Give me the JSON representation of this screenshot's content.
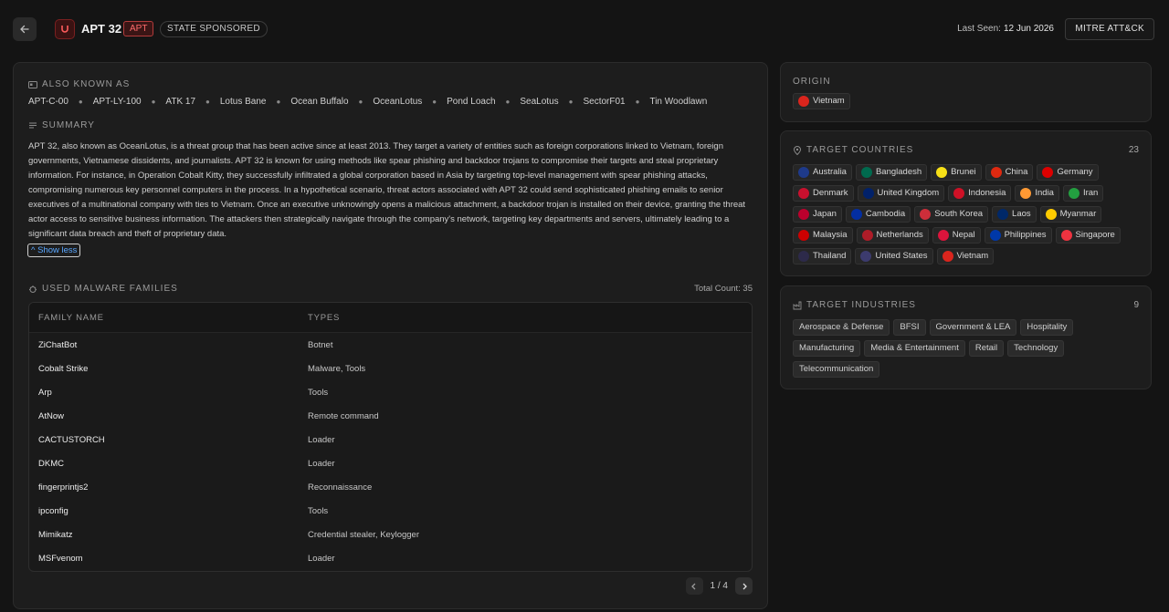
{
  "header": {
    "back_icon": "arrow-left-icon",
    "title": "APT 32",
    "apt_badge": "APT",
    "state_badge": "STATE SPONSORED",
    "last_seen_label": "Last Seen:",
    "last_seen_value": "12 Jun 2026",
    "mitre_button": "MITRE ATT&CK"
  },
  "aka": {
    "label": "ALSO KNOWN AS",
    "names": [
      "APT-C-00",
      "APT-LY-100",
      "ATK 17",
      "Lotus Bane",
      "Ocean Buffalo",
      "OceanLotus",
      "Pond Loach",
      "SeaLotus",
      "SectorF01",
      "Tin Woodlawn"
    ]
  },
  "summary": {
    "label": "SUMMARY",
    "text": "APT 32, also known as OceanLotus, is a threat group that has been active since at least 2013. They target a variety of entities such as foreign corporations linked to Vietnam, foreign governments, Vietnamese dissidents, and journalists. APT 32 is known for using methods like spear phishing and backdoor trojans to compromise their targets and steal proprietary information. For instance, in Operation Cobalt Kitty, they successfully infiltrated a global corporation based in Asia by targeting top-level management with spear phishing attacks, compromising numerous key personnel computers in the process. In a hypothetical scenario, threat actors associated with APT 32 could send sophisticated phishing emails to senior executives of a multinational company with ties to Vietnam. Once an executive unknowingly opens a malicious attachment, a backdoor trojan is installed on their device, granting the threat actor access to sensitive business information. The attackers then strategically navigate through the company's network, targeting key departments and servers, ultimately leading to a significant data breach and theft of proprietary data.",
    "show_less": "Show less"
  },
  "malware": {
    "label": "USED MALWARE FAMILIES",
    "total_count": "Total Count: 35",
    "col_family": "FAMILY NAME",
    "col_types": "TYPES",
    "rows": [
      {
        "name": "ZiChatBot",
        "types": "Botnet"
      },
      {
        "name": "Cobalt Strike",
        "types": "Malware, Tools"
      },
      {
        "name": "Arp",
        "types": "Tools"
      },
      {
        "name": "AtNow",
        "types": "Remote command"
      },
      {
        "name": "CACTUSTORCH",
        "types": "Loader"
      },
      {
        "name": "DKMC",
        "types": "Loader"
      },
      {
        "name": "fingerprintjs2",
        "types": "Reconnaissance"
      },
      {
        "name": "ipconfig",
        "types": "Tools"
      },
      {
        "name": "Mimikatz",
        "types": "Credential stealer, Keylogger"
      },
      {
        "name": "MSFvenom",
        "types": "Loader"
      }
    ],
    "page": "1 / 4"
  },
  "origin": {
    "label": "ORIGIN",
    "country": "Vietnam",
    "flag_color": "#da251d"
  },
  "countries": {
    "label": "TARGET COUNTRIES",
    "count": "23",
    "items": [
      {
        "name": "Australia",
        "color": "#1e3a8a"
      },
      {
        "name": "Bangladesh",
        "color": "#006a4e"
      },
      {
        "name": "Brunei",
        "color": "#f7e017"
      },
      {
        "name": "China",
        "color": "#de2910"
      },
      {
        "name": "Germany",
        "color": "#dd0000"
      },
      {
        "name": "Denmark",
        "color": "#c8102e"
      },
      {
        "name": "United Kingdom",
        "color": "#012169"
      },
      {
        "name": "Indonesia",
        "color": "#ce1126"
      },
      {
        "name": "India",
        "color": "#ff9933"
      },
      {
        "name": "Iran",
        "color": "#239f40"
      },
      {
        "name": "Japan",
        "color": "#bc002d"
      },
      {
        "name": "Cambodia",
        "color": "#032ea1"
      },
      {
        "name": "South Korea",
        "color": "#cd2e3a"
      },
      {
        "name": "Laos",
        "color": "#002868"
      },
      {
        "name": "Myanmar",
        "color": "#fecb00"
      },
      {
        "name": "Malaysia",
        "color": "#cc0001"
      },
      {
        "name": "Netherlands",
        "color": "#ae1c28"
      },
      {
        "name": "Nepal",
        "color": "#dc143c"
      },
      {
        "name": "Philippines",
        "color": "#0038a8"
      },
      {
        "name": "Singapore",
        "color": "#ef3340"
      },
      {
        "name": "Thailand",
        "color": "#2d2a4a"
      },
      {
        "name": "United States",
        "color": "#3c3b6e"
      },
      {
        "name": "Vietnam",
        "color": "#da251d"
      }
    ]
  },
  "industries": {
    "label": "TARGET INDUSTRIES",
    "count": "9",
    "items": [
      "Aerospace & Defense",
      "BFSI",
      "Government & LEA",
      "Hospitality",
      "Manufacturing",
      "Media & Entertainment",
      "Retail",
      "Technology",
      "Telecommunication"
    ]
  }
}
